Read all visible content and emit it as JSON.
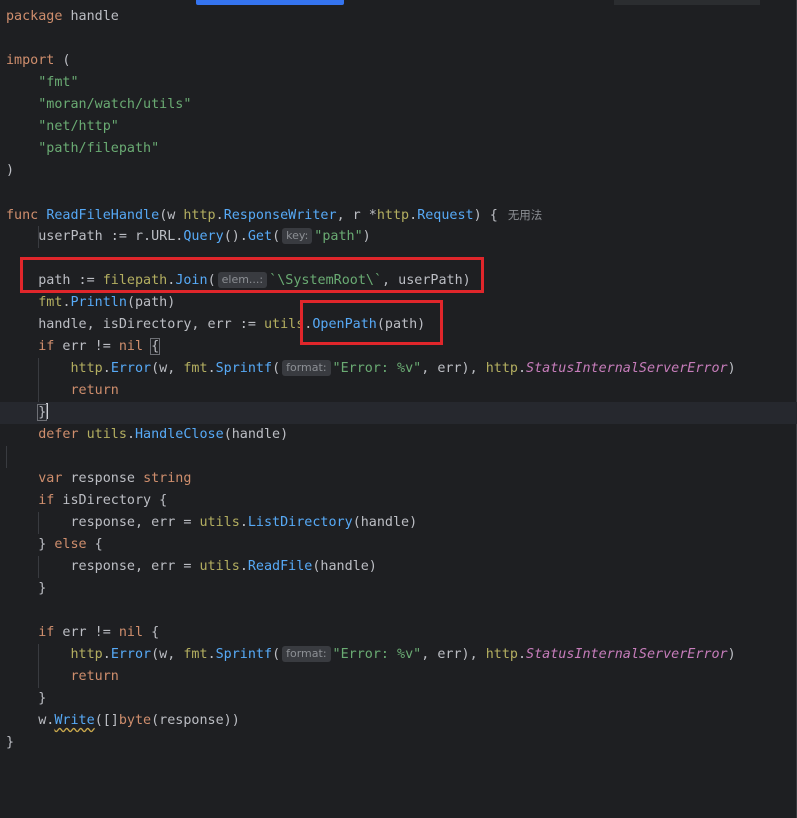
{
  "colors": {
    "background": "#1e1f22",
    "keyword": "#cf8e6d",
    "string": "#6aab73",
    "function": "#56a8f5",
    "package": "#b3ae60",
    "constant": "#c77dbb",
    "highlight_box": "#e0262b"
  },
  "code": {
    "l1_kw": "package",
    "l1_name": " handle",
    "l3_kw": "import",
    "l3_rest": " (",
    "imp1": "\"fmt\"",
    "imp2": "\"moran/watch/utils\"",
    "imp3": "\"net/http\"",
    "imp4": "\"path/filepath\"",
    "close_paren": ")",
    "func_kw": "func",
    "func_name": "ReadFileHandle",
    "func_open": "(w ",
    "http1": "http",
    "dot": ".",
    "response_writer": "ResponseWriter",
    "comma_r": ", r *",
    "http2": "http",
    "request_type": "Request",
    "func_close": ") {",
    "usage_hint": "无用法",
    "userpath_assign": "userPath := r.URL.",
    "query": "Query",
    "paren_dot": "().",
    "get": "Get",
    "open_paren": "(",
    "hint_key": "key:",
    "path_str": "\"path\"",
    "close": ")",
    "path_assign": "path := ",
    "filepath_pkg": "filepath",
    "join": "Join",
    "hint_elem": "elem...:",
    "systemroot_str": "`\\SystemRoot\\`",
    "join_rest": ", userPath)",
    "fmt_pkg": "fmt",
    "println": "Println",
    "println_args": "(path)",
    "handle_assign": "handle, isDirectory, err := ",
    "utils_pkg": "utils",
    "openpath": "OpenPath",
    "openpath_args": "(path)",
    "if_kw": "if",
    "err_neq": " err != ",
    "nil_kw": "nil",
    "open_brace": "{",
    "http_pkg": "http",
    "error_fn": "Error",
    "w_arg": "(w, ",
    "sprintf": "Sprintf",
    "hint_format": "format:",
    "error_str": "\"Error: %v\"",
    "err_arg": ", err), ",
    "status_const": "StatusInternalServerError",
    "return_kw": "return",
    "close_brace": "}",
    "defer_kw": "defer",
    "handleclose": "HandleClose",
    "handle_arg": "(handle)",
    "var_kw": "var",
    "response_var": " response ",
    "string_kw": "string",
    "isdir_cond": " isDirectory {",
    "response_assign": "response, err = ",
    "listdir": "ListDirectory",
    "else_open": "} ",
    "else_kw": "else",
    "else_brace": " {",
    "readfile": "ReadFile",
    "w_dot": "w.",
    "write_fn": "Write",
    "byte_open": "([]",
    "byte_kw": "byte",
    "byte_args": "(response))"
  }
}
